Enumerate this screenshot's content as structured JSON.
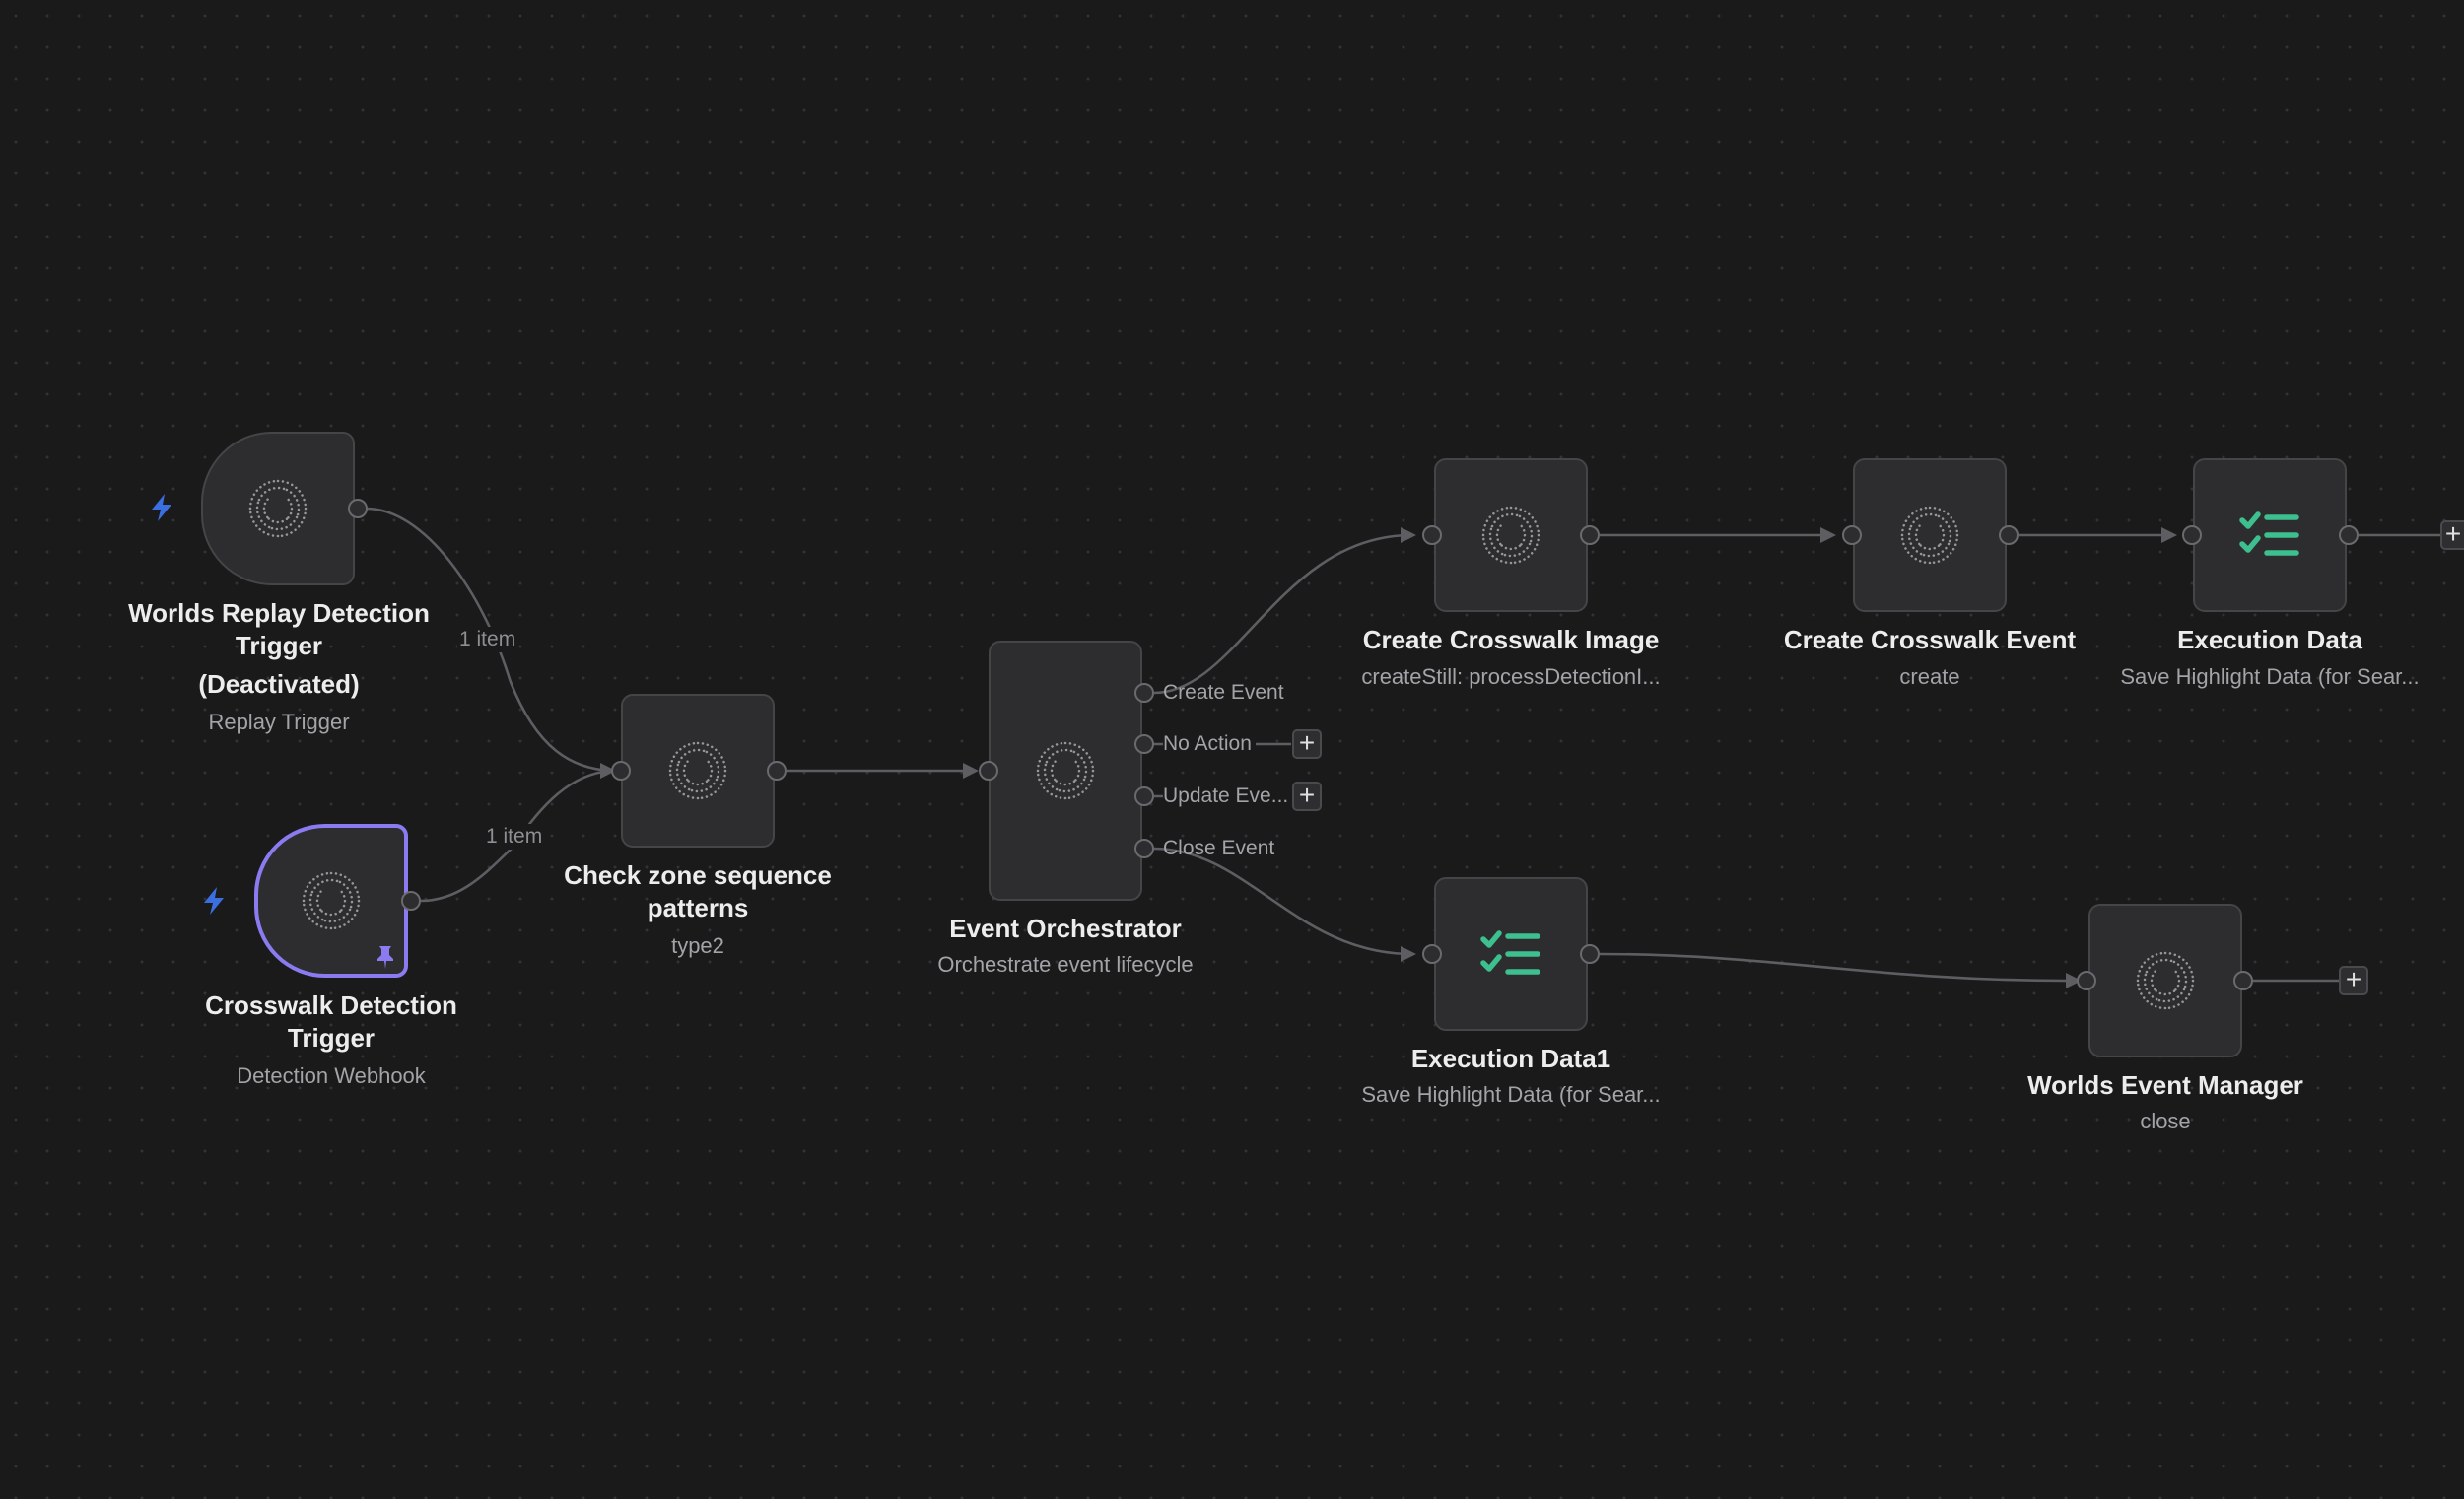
{
  "nodes": {
    "replay_trigger": {
      "title_line1": "Worlds Replay Detection",
      "title_line2": "Trigger",
      "title_line3": "(Deactivated)",
      "subtitle": "Replay Trigger",
      "icon": "swirl-logo-icon"
    },
    "crosswalk_trigger": {
      "title_line1": "Crosswalk Detection",
      "title_line2": "Trigger",
      "subtitle": "Detection Webhook",
      "icon": "swirl-logo-icon",
      "pinned": true
    },
    "check_zone": {
      "title_line1": "Check zone sequence",
      "title_line2": "patterns",
      "subtitle": "type2",
      "icon": "swirl-logo-icon"
    },
    "orchestrator": {
      "title": "Event Orchestrator",
      "subtitle": "Orchestrate event lifecycle",
      "icon": "swirl-logo-icon",
      "outputs": [
        "Create Event",
        "No Action",
        "Update Eve...",
        "Close Event"
      ]
    },
    "create_image": {
      "title": "Create Crosswalk Image",
      "subtitle": "createStill: processDetectionI...",
      "icon": "swirl-logo-icon"
    },
    "create_event": {
      "title": "Create Crosswalk Event",
      "subtitle": "create",
      "icon": "swirl-logo-icon"
    },
    "execution_data": {
      "title": "Execution Data",
      "subtitle": "Save Highlight Data (for Sear...",
      "icon": "checklist-icon"
    },
    "execution_data1": {
      "title": "Execution Data1",
      "subtitle": "Save Highlight Data (for Sear...",
      "icon": "checklist-icon"
    },
    "event_manager": {
      "title": "Worlds Event Manager",
      "subtitle": "close",
      "icon": "swirl-logo-icon"
    }
  },
  "edges": {
    "replay_items": "1 item",
    "crosswalk_items": "1 item"
  },
  "plus_symbol": "+",
  "colors": {
    "canvas_bg": "#1a1a1b",
    "node_bg": "#2d2d2f",
    "pinned_border": "#8a7bf0",
    "trigger_bolt": "#3b6fe0",
    "checklist": "#3dbf8f",
    "edge": "#5e5e62"
  }
}
